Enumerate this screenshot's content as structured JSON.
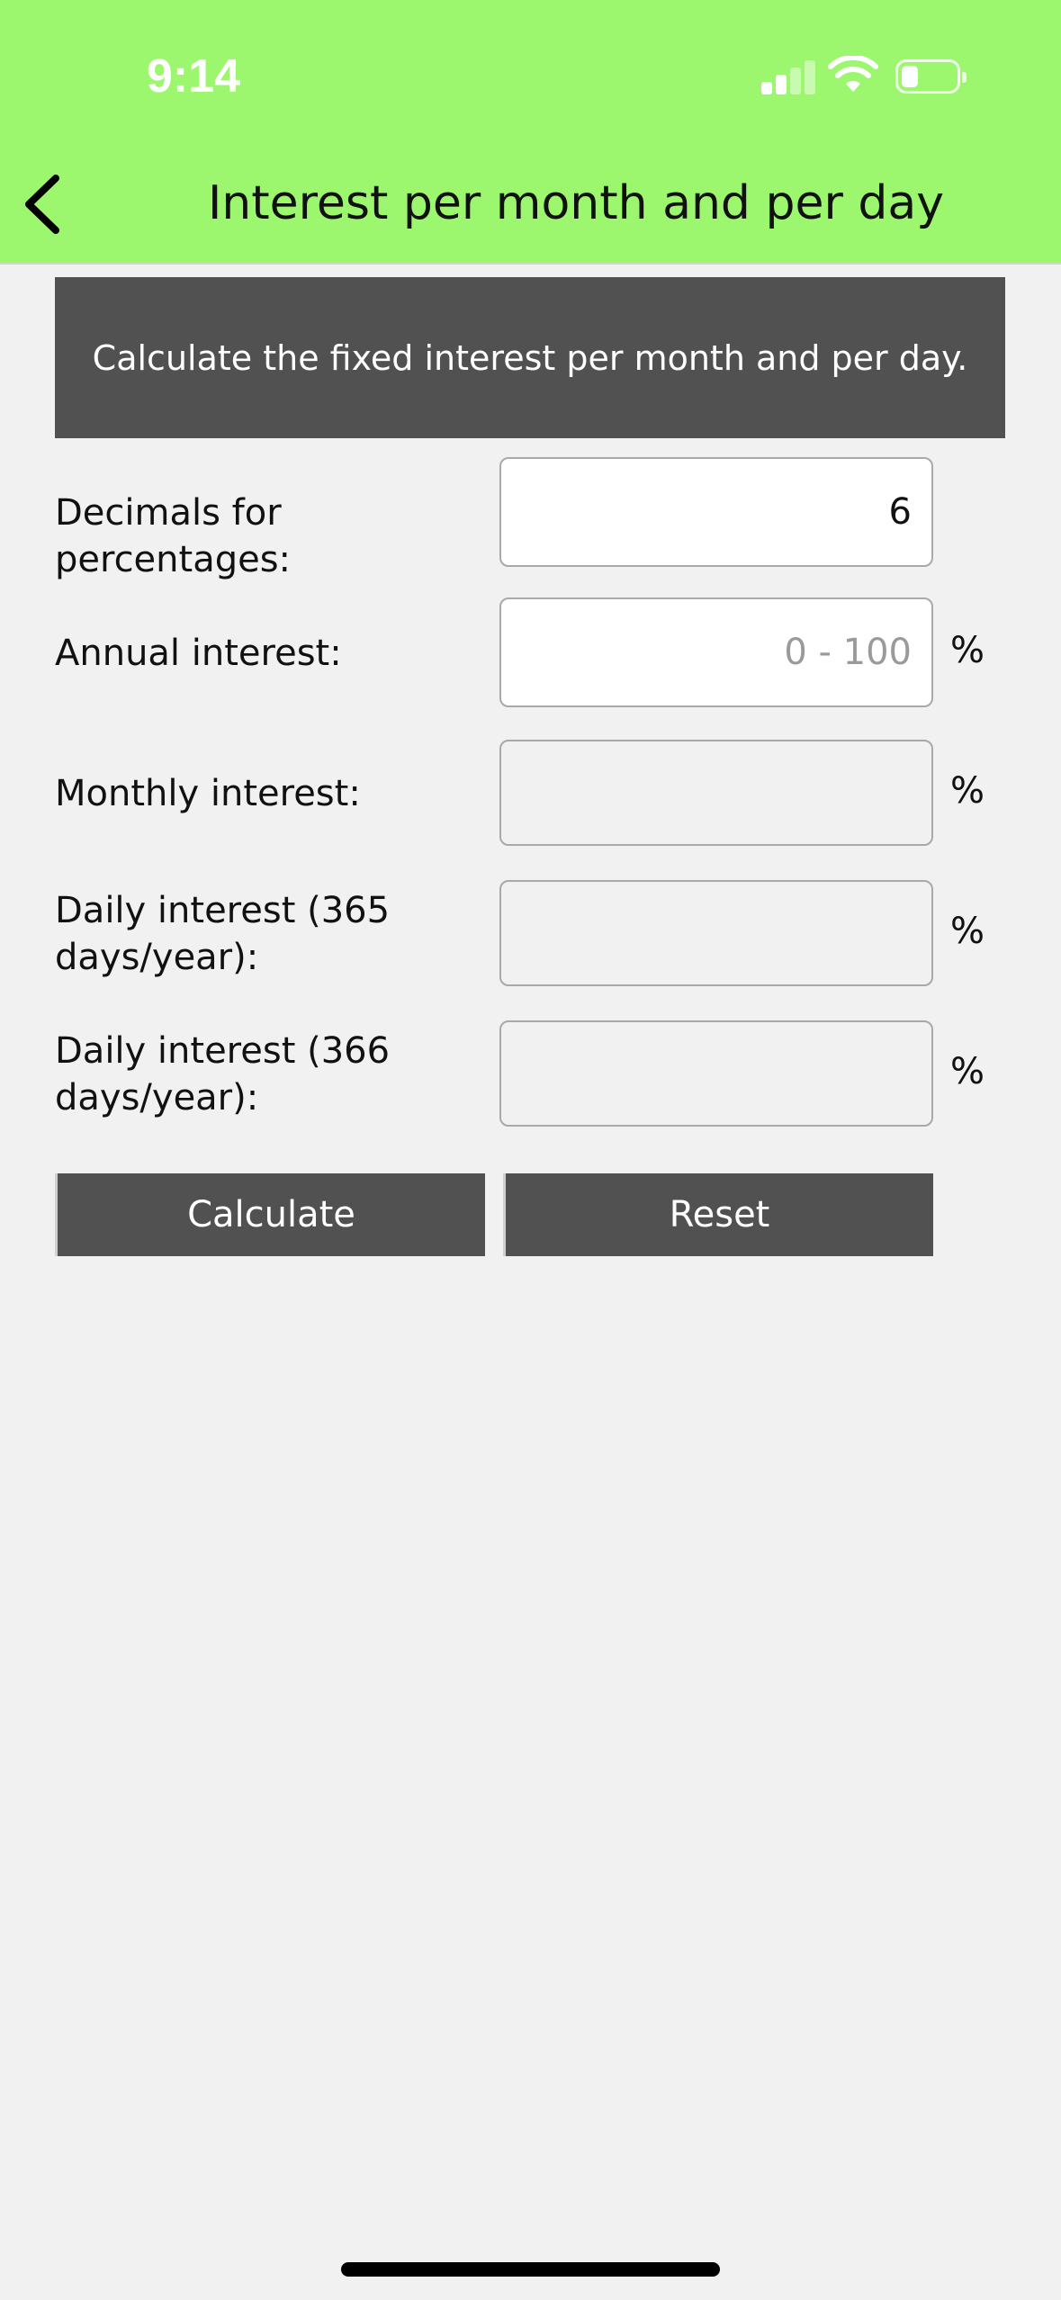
{
  "status_bar": {
    "time": "9:14"
  },
  "nav": {
    "title": "Interest per month and per day"
  },
  "description": "Calculate the fixed interest per month and per day.",
  "form": {
    "decimals": {
      "label": "Decimals for percentages:",
      "value": "6"
    },
    "annual": {
      "label": "Annual interest:",
      "value": "",
      "placeholder": "0 - 100",
      "unit": "%"
    },
    "monthly": {
      "label": "Monthly interest:",
      "value": "",
      "unit": "%"
    },
    "daily365": {
      "label": "Daily interest (365 days/year):",
      "value": "",
      "unit": "%"
    },
    "daily366": {
      "label": "Daily interest (366 days/year):",
      "value": "",
      "unit": "%"
    }
  },
  "buttons": {
    "calculate": "Calculate",
    "reset": "Reset"
  },
  "colors": {
    "header_bg": "#9cf76e",
    "panel_bg": "#515151",
    "page_bg": "#f1f1f1"
  },
  "icons": {
    "back": "chevron-left-icon",
    "signal": "cellular-signal-icon",
    "wifi": "wifi-icon",
    "battery": "battery-icon"
  }
}
